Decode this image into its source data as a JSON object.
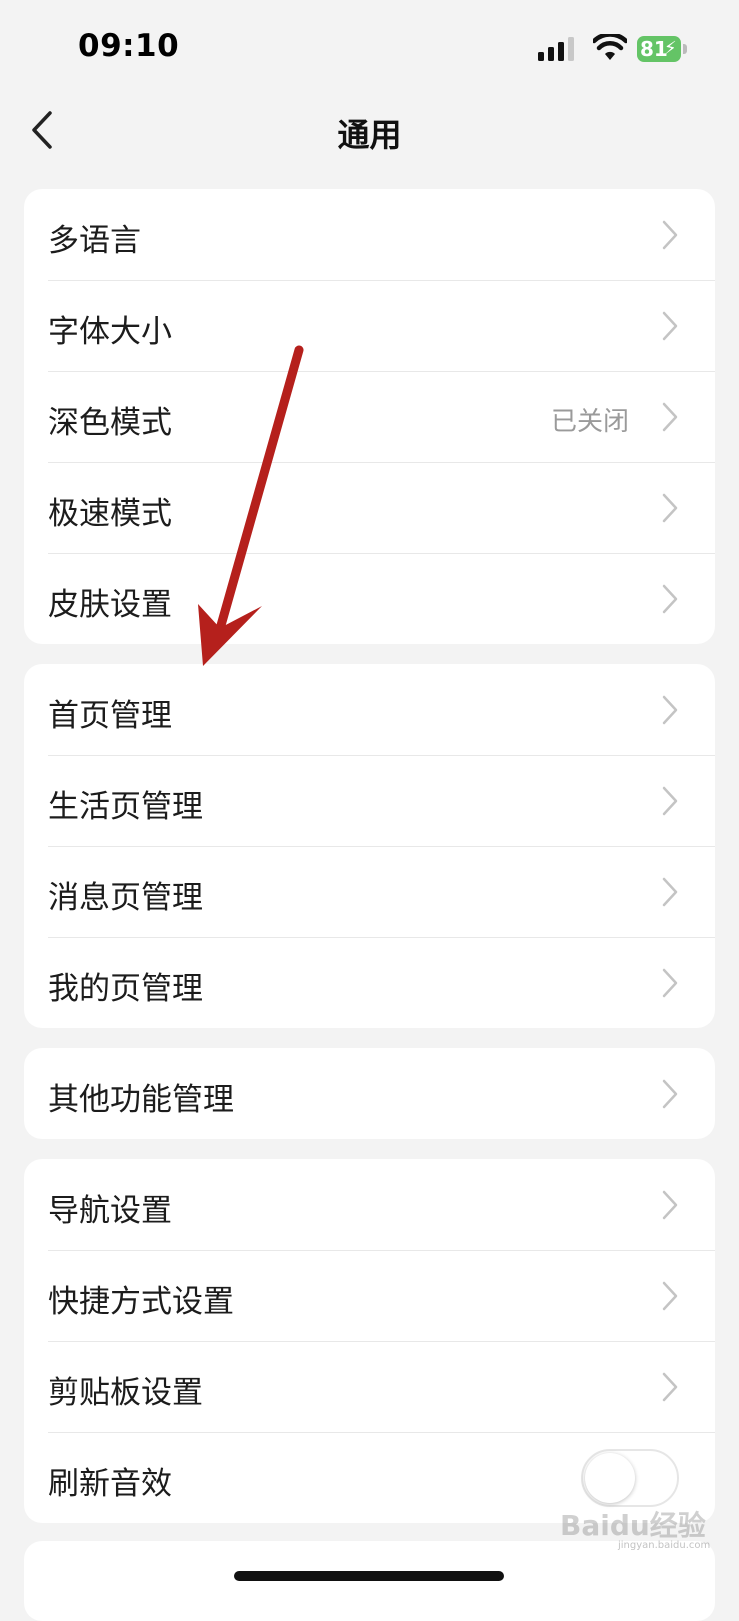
{
  "status_bar": {
    "time": "09:10",
    "battery_level": "81"
  },
  "nav": {
    "title": "通用"
  },
  "groups": [
    {
      "items": [
        {
          "label": "多语言"
        },
        {
          "label": "字体大小"
        },
        {
          "label": "深色模式",
          "value": "已关闭"
        },
        {
          "label": "极速模式"
        },
        {
          "label": "皮肤设置"
        }
      ]
    },
    {
      "items": [
        {
          "label": "首页管理"
        },
        {
          "label": "生活页管理"
        },
        {
          "label": "消息页管理"
        },
        {
          "label": "我的页管理"
        }
      ]
    },
    {
      "items": [
        {
          "label": "其他功能管理"
        }
      ]
    },
    {
      "items": [
        {
          "label": "导航设置"
        },
        {
          "label": "快捷方式设置"
        },
        {
          "label": "剪贴板设置"
        },
        {
          "label": "刷新音效",
          "toggle": false
        }
      ]
    }
  ],
  "watermark": {
    "text": "Baidu经验",
    "sub": "jingyan.baidu.com"
  },
  "colors": {
    "background": "#f3f3f3",
    "card": "#ffffff",
    "battery": "#64c466",
    "annotation_arrow": "#b5201c"
  }
}
